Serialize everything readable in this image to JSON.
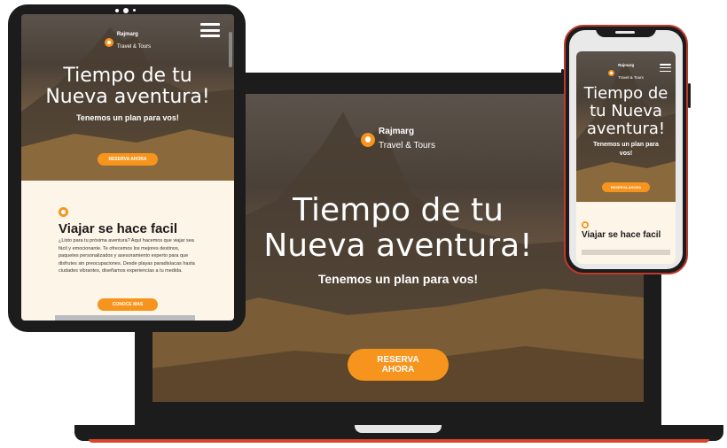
{
  "brand": {
    "name": "Rajmarg",
    "tagline": "Travel & Tours"
  },
  "hero": {
    "title_line1": "Tiempo de tu",
    "title_line2": "Nueva aventura!",
    "subtitle": "Tenemos un plan para vos!",
    "cta": "RESERVA AHORA"
  },
  "about": {
    "title": "Viajar se hace facil",
    "text": "¿Listo para tu próxima aventura? Aquí hacemos que viajar sea fácil y emocionante. Te ofrecemos los mejores destinos, paquetes personalizados y asesoramiento experto para que disfrutes sin preocupaciones. Desde playas paradisíacas hasta ciudades vibrantes, diseñamos experiencias a tu medida.",
    "cta": "CONOCE MAS"
  },
  "phone_hero": {
    "title_line1": "Tiempo de",
    "title_line2": "tu Nueva",
    "title_line3": "aventura!"
  },
  "colors": {
    "accent": "#f7941d",
    "dark": "#1c1c1c",
    "cream": "#fdf5e8"
  },
  "icons": [
    "location-pin-icon",
    "hamburger-menu-icon"
  ]
}
